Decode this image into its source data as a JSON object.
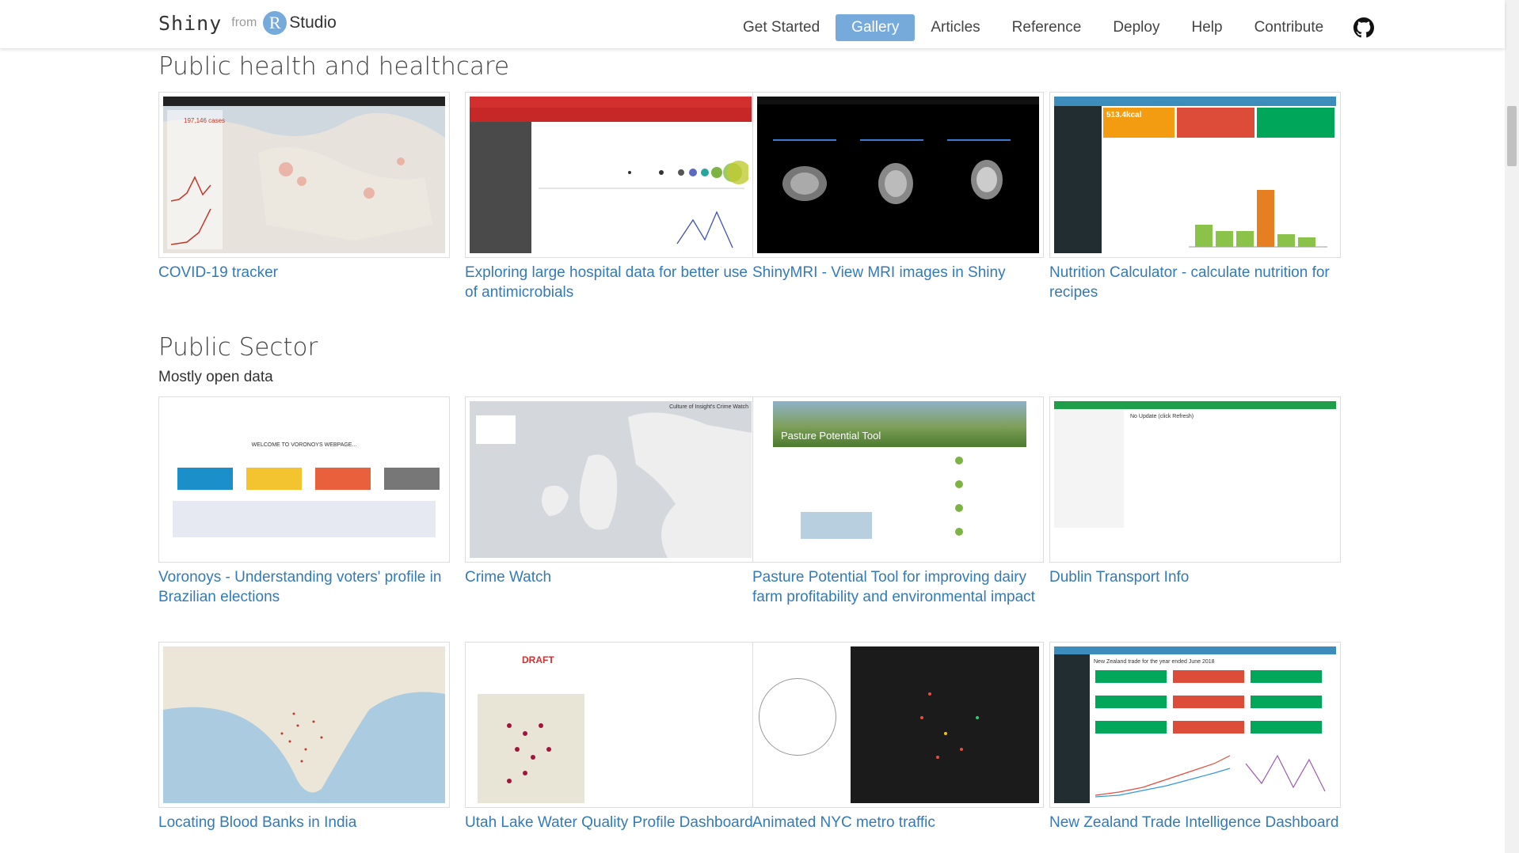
{
  "header": {
    "brand_name": "Shiny",
    "brand_from": "from",
    "brand_r": "R",
    "brand_studio": "Studio",
    "nav": [
      "Get Started",
      "Gallery",
      "Articles",
      "Reference",
      "Deploy",
      "Help",
      "Contribute"
    ],
    "active_nav": "Gallery"
  },
  "sections": {
    "health": {
      "title": "Public health and healthcare"
    },
    "public_sector": {
      "title": "Public Sector",
      "subtitle": "Mostly open data"
    }
  },
  "cards": [
    {
      "title": "COVID-19 tracker",
      "thumb_text": "197,146 cases"
    },
    {
      "title": "Exploring large hospital data for better use of antimicrobials",
      "thumb_text": ""
    },
    {
      "title": "ShinyMRI - View MRI images in Shiny",
      "thumb_text": ""
    },
    {
      "title": "Nutrition Calculator - calculate nutrition for recipes",
      "thumb_text": "513.4kcal"
    },
    {
      "title": "Voronoys - Understanding voters' profile in Brazilian elections",
      "thumb_text": "WELCOME TO VORONOYS WEBPAGE..."
    },
    {
      "title": "Crime Watch",
      "thumb_text": "Culture of Insight's Crime Watch"
    },
    {
      "title": "Pasture Potential Tool for improving dairy farm profitability and environmental impact",
      "thumb_text": "Pasture Potential Tool"
    },
    {
      "title": "Dublin Transport Info",
      "thumb_text": "No Update (click Refresh)"
    },
    {
      "title": "Locating Blood Banks in India",
      "thumb_text": ""
    },
    {
      "title": "Utah Lake Water Quality Profile Dashboard",
      "thumb_text": "DRAFT"
    },
    {
      "title": "Animated NYC metro traffic",
      "thumb_text": ""
    },
    {
      "title": "New Zealand Trade Intelligence Dashboard",
      "thumb_text": "New Zealand trade for the year ended June 2018"
    }
  ],
  "colors": {
    "accent": "#75aadb",
    "link": "#337ab7"
  }
}
